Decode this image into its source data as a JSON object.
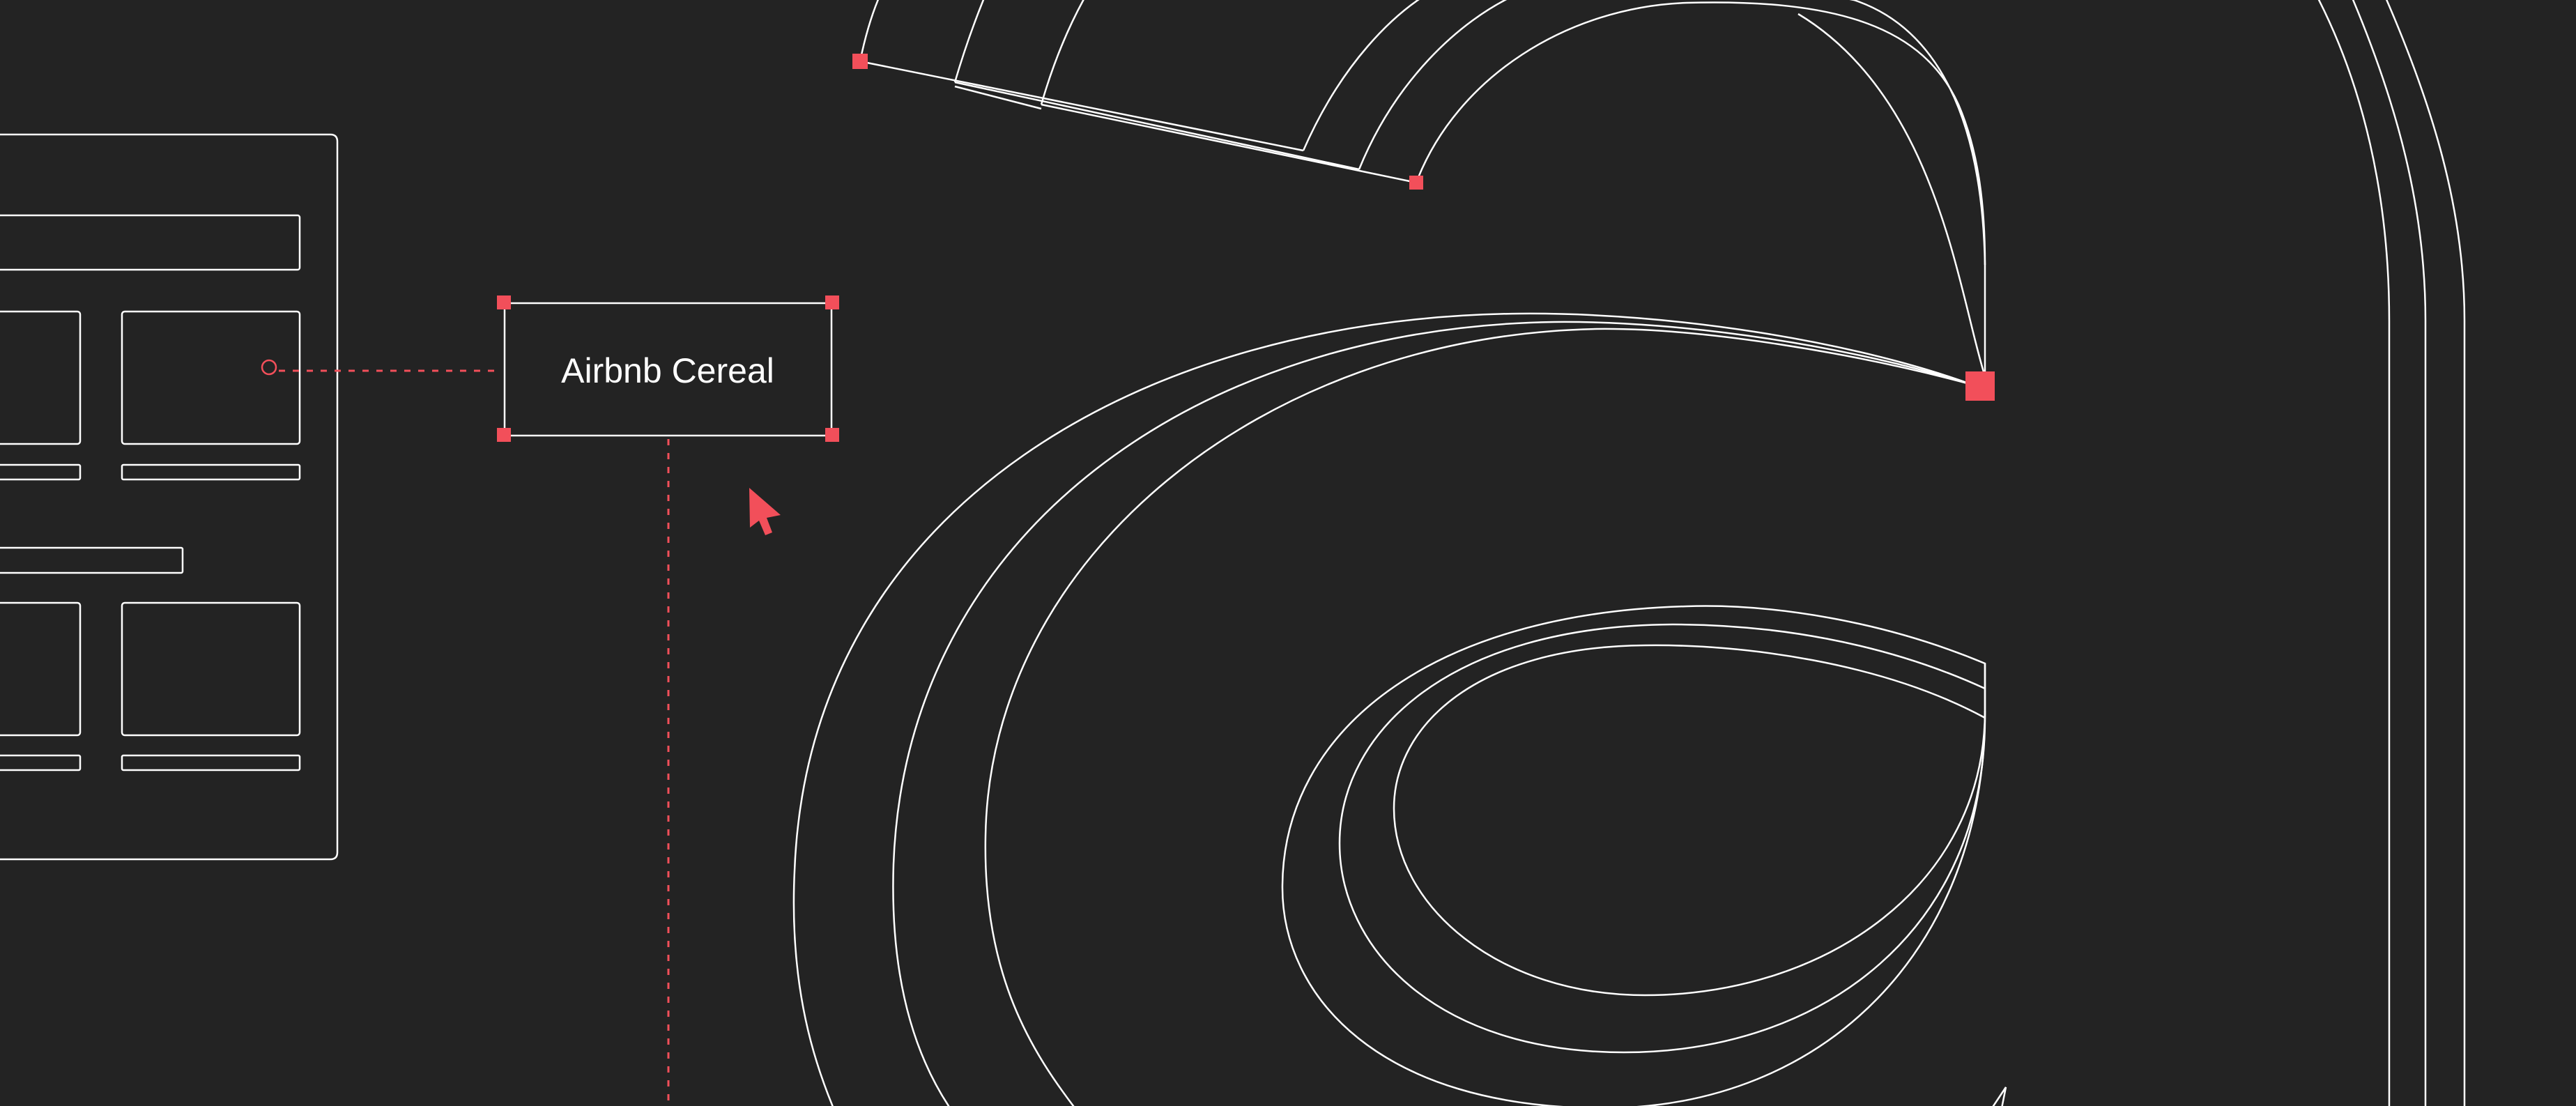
{
  "label": {
    "text": "Airbnb Cereal"
  },
  "colors": {
    "background": "#232323",
    "stroke": "#ffffff",
    "accent": "#f24f5a"
  },
  "icons": {
    "cursor": "pointer-arrow-icon",
    "anchor": "bezier-anchor-handle-icon",
    "connector": "connector-node-icon"
  }
}
